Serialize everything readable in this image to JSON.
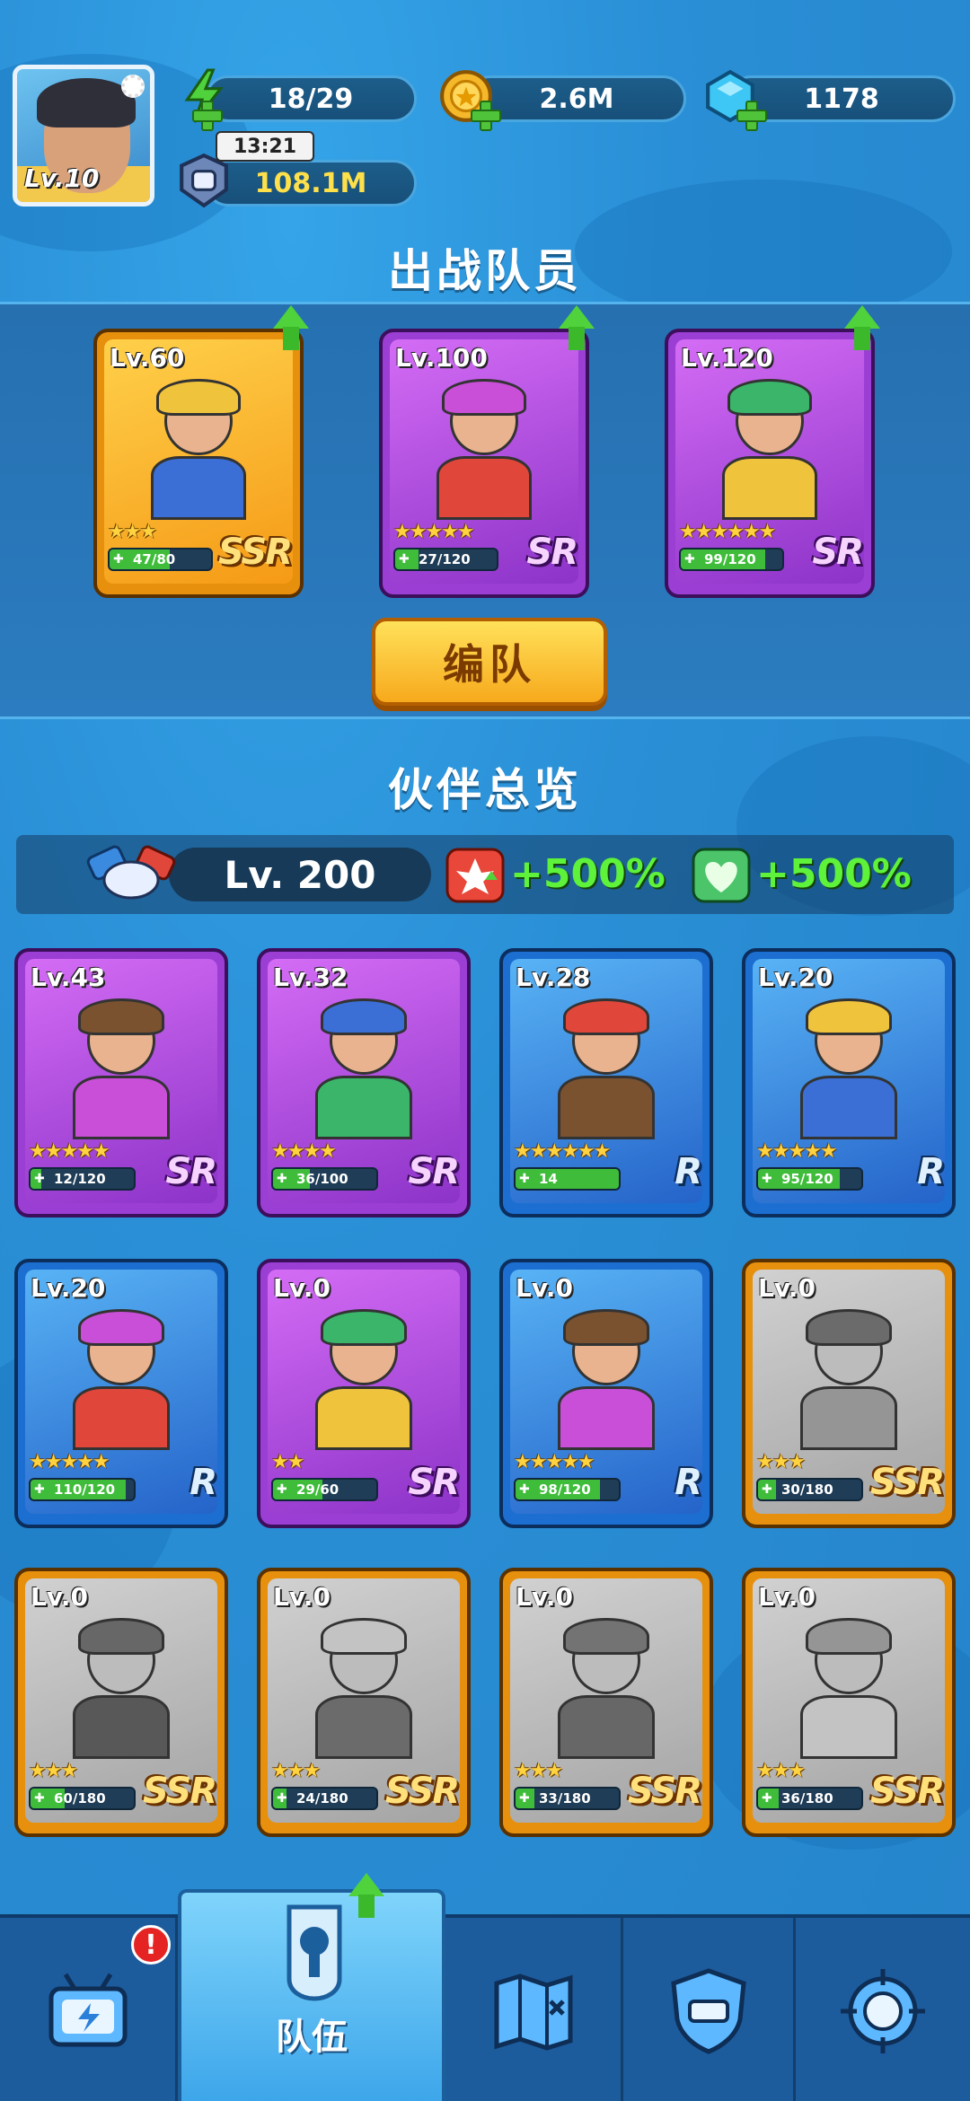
{
  "header": {
    "player_level": "Lv.10",
    "energy": "18/29",
    "energy_timer": "13:21",
    "coins": "2.6M",
    "gems": "1178",
    "power": "108.1M"
  },
  "team": {
    "title": "出战队员",
    "formation_button": "编队",
    "members": [
      {
        "level": "Lv.60",
        "stars": "★★★",
        "fragments": "47/80",
        "fragment_ratio": 0.59,
        "rarity": "SSR",
        "upgradable": true
      },
      {
        "level": "Lv.100",
        "stars": "★★★★★",
        "fragments": "27/120",
        "fragment_ratio": 0.23,
        "rarity": "SR",
        "upgradable": true
      },
      {
        "level": "Lv.120",
        "stars": "★★★★★★",
        "fragments": "99/120",
        "fragment_ratio": 0.83,
        "rarity": "SR",
        "upgradable": true
      }
    ]
  },
  "overview": {
    "title": "伙伴总览",
    "partner_level": "Lv. 200",
    "attack_bonus": "+500%",
    "hp_bonus": "+500%",
    "partners": [
      {
        "level": "Lv.43",
        "stars": "★★★★★",
        "fragments": "12/120",
        "fragment_ratio": 0.1,
        "rarity": "SR",
        "owned": true
      },
      {
        "level": "Lv.32",
        "stars": "★★★★",
        "fragments": "36/100",
        "fragment_ratio": 0.36,
        "rarity": "SR",
        "owned": true
      },
      {
        "level": "Lv.28",
        "stars": "★★★★★★",
        "fragments": "14",
        "fragment_ratio": 1.0,
        "rarity": "R",
        "owned": true
      },
      {
        "level": "Lv.20",
        "stars": "★★★★★",
        "fragments": "95/120",
        "fragment_ratio": 0.79,
        "rarity": "R",
        "owned": true
      },
      {
        "level": "Lv.20",
        "stars": "★★★★★",
        "fragments": "110/120",
        "fragment_ratio": 0.92,
        "rarity": "R",
        "owned": true
      },
      {
        "level": "Lv.0",
        "stars": "★★",
        "fragments": "29/60",
        "fragment_ratio": 0.48,
        "rarity": "SR",
        "owned": true
      },
      {
        "level": "Lv.0",
        "stars": "★★★★★",
        "fragments": "98/120",
        "fragment_ratio": 0.82,
        "rarity": "R",
        "owned": true
      },
      {
        "level": "Lv.0",
        "stars": "★★★",
        "fragments": "30/180",
        "fragment_ratio": 0.17,
        "rarity": "SSR",
        "owned": false
      },
      {
        "level": "Lv.0",
        "stars": "★★★",
        "fragments": "60/180",
        "fragment_ratio": 0.33,
        "rarity": "SSR",
        "owned": false
      },
      {
        "level": "Lv.0",
        "stars": "★★★",
        "fragments": "24/180",
        "fragment_ratio": 0.13,
        "rarity": "SSR",
        "owned": false
      },
      {
        "level": "Lv.0",
        "stars": "★★★",
        "fragments": "33/180",
        "fragment_ratio": 0.18,
        "rarity": "SSR",
        "owned": false
      },
      {
        "level": "Lv.0",
        "stars": "★★★",
        "fragments": "36/180",
        "fragment_ratio": 0.2,
        "rarity": "SSR",
        "owned": false
      }
    ]
  },
  "nav": {
    "team_label": "队伍",
    "notification_badge": "!",
    "icons": [
      "tv-shop-icon",
      "team-icon",
      "map-icon",
      "shield-icon",
      "target-icon"
    ]
  },
  "colors": {
    "background": "#2a8fd6",
    "ssr": "#e7900d",
    "sr": "#9b3ed4",
    "r": "#1c6fd0",
    "bonus_green": "#5ef23a"
  }
}
